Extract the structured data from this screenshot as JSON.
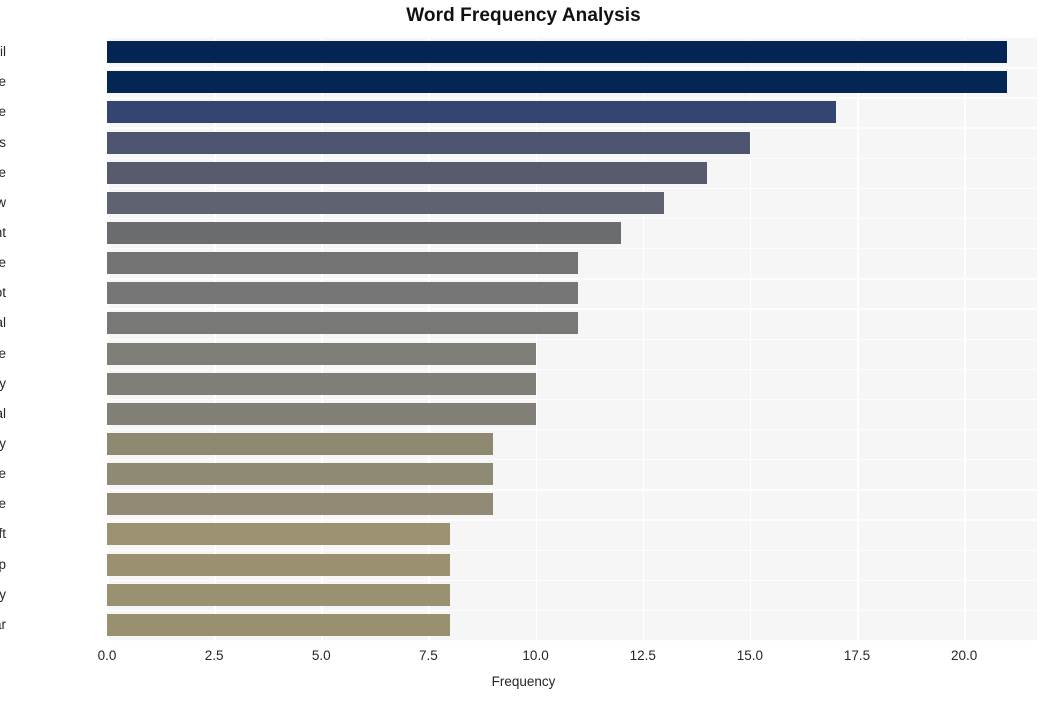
{
  "chart_data": {
    "type": "bar",
    "orientation": "horizontal",
    "title": "Word Frequency Analysis",
    "xlabel": "Frequency",
    "ylabel": "",
    "categories": [
      "retail",
      "crime",
      "organize",
      "retailers",
      "case",
      "law",
      "enforcement",
      "home",
      "depot",
      "steal",
      "store",
      "company",
      "federal",
      "security",
      "police",
      "state",
      "theft",
      "group",
      "industry",
      "year"
    ],
    "values": [
      21,
      21,
      17,
      15,
      14,
      13,
      12,
      11,
      11,
      11,
      10,
      10,
      10,
      9,
      9,
      9,
      8,
      8,
      8,
      8
    ],
    "bar_colors": [
      "#042454",
      "#042654",
      "#334570",
      "#4c5470",
      "#585b6d",
      "#5f6270",
      "#6b6c70",
      "#737373",
      "#767676",
      "#787877",
      "#7e7d76",
      "#807f77",
      "#827f76",
      "#8d886f",
      "#8f8a73",
      "#918b76",
      "#9c9272",
      "#9b9171",
      "#9a9170",
      "#99906f"
    ],
    "xlim": [
      0,
      21.7
    ],
    "xticks": [
      "0.0",
      "2.5",
      "5.0",
      "7.5",
      "10.0",
      "12.5",
      "15.0",
      "17.5",
      "20.0"
    ],
    "xtick_values": [
      0,
      2.5,
      5,
      7.5,
      10,
      12.5,
      15,
      17.5,
      20
    ],
    "grid": true,
    "legend": "none",
    "plot_background": "#f6f6f6",
    "grid_color": "#ffffff"
  }
}
